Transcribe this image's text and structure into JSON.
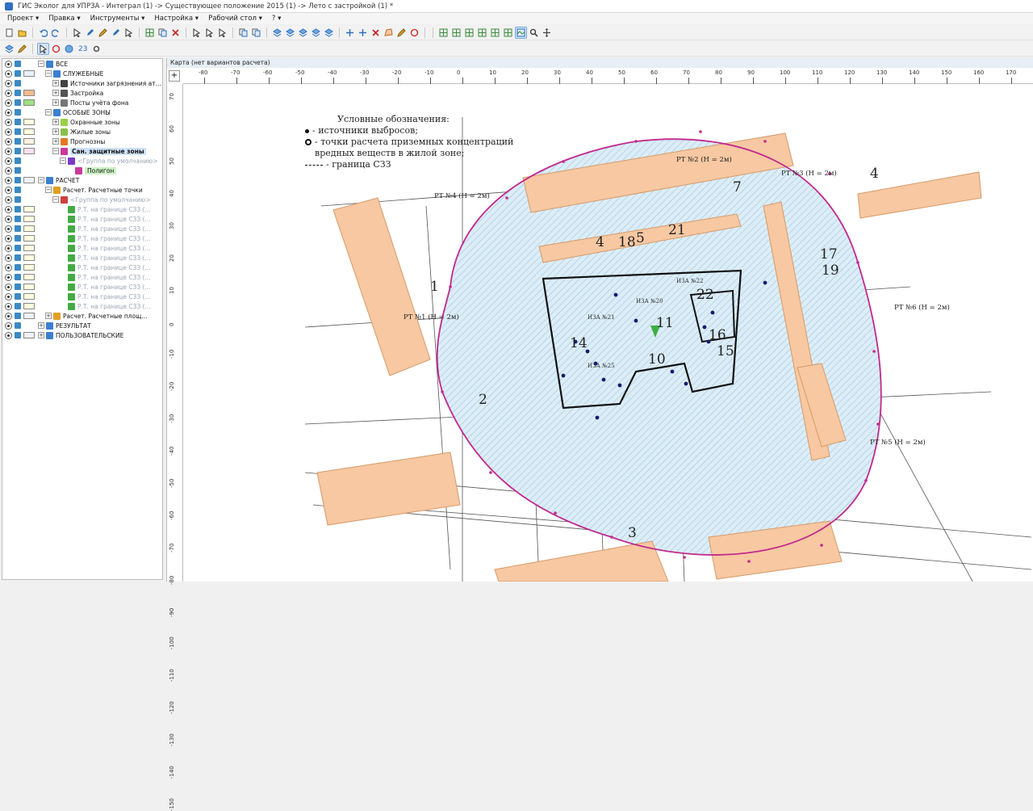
{
  "window": {
    "title": "ГИС Эколог для УПРЗА - Интеграл (1) -> Существующее положение 2015 (1) -> Лето с застройкой (1) *"
  },
  "menu": [
    "Проект ▾",
    "Правка ▾",
    "Инструменты ▾",
    "Настройка ▾",
    "Рабочий стол ▾",
    "? ▾"
  ],
  "toolbar": {
    "zoom_value": "23"
  },
  "tree": {
    "items": [
      {
        "label": "ВСЕ",
        "level": 0,
        "expand": "−",
        "icon": "folder-icon",
        "color": "#3b7fd1",
        "swatch": ""
      },
      {
        "label": "СЛУЖЕБНЫЕ",
        "level": 1,
        "expand": "−",
        "icon": "folder-icon",
        "color": "#3b7fd1",
        "swatch": "#e9f1fb"
      },
      {
        "label": "Источники загрязнения ат...",
        "level": 2,
        "expand": "+",
        "icon": "source-icon",
        "color": "#444",
        "swatch": ""
      },
      {
        "label": "Застройка",
        "level": 2,
        "expand": "+",
        "icon": "building-icon",
        "color": "#555",
        "swatch": "#f4b98c"
      },
      {
        "label": "Посты учёта фона",
        "level": 2,
        "expand": "+",
        "icon": "post-icon",
        "color": "#777",
        "swatch": "#9fe07e"
      },
      {
        "label": "ОСОБЫЕ ЗОНЫ",
        "level": 1,
        "expand": "−",
        "icon": "folder-icon",
        "color": "#3b7fd1",
        "swatch": ""
      },
      {
        "label": "Охранные зоны",
        "level": 2,
        "expand": "+",
        "icon": "zone-icon",
        "color": "#9ad04a",
        "swatch": "#ffffdf"
      },
      {
        "label": "Жилые зоны",
        "level": 2,
        "expand": "+",
        "icon": "zone-icon",
        "color": "#8ac04a",
        "swatch": "#ffffdf"
      },
      {
        "label": "Прогнозны",
        "level": 2,
        "expand": "+",
        "icon": "zone-icon",
        "color": "#e07a24",
        "swatch": "#fff2df"
      },
      {
        "label": "Сан. защитные зоны",
        "level": 2,
        "expand": "−",
        "icon": "zone-icon",
        "color": "#c93a9a",
        "swatch": "#fbe0f2",
        "highlight": true
      },
      {
        "label": "<Группа по умолчанию>",
        "level": 3,
        "expand": "−",
        "icon": "group-icon",
        "color": "#7a3ac9",
        "swatch": "",
        "faded": true
      },
      {
        "label": "Полигон",
        "level": 4,
        "expand": "",
        "icon": "polygon-icon",
        "color": "#c93a9a",
        "swatch": "",
        "green": true
      },
      {
        "label": "РАСЧЕТ",
        "level": 0,
        "expand": "−",
        "icon": "folder-icon",
        "color": "#3b7fd1",
        "swatch": "#eef2f8"
      },
      {
        "label": "Расчет. Расчетные точки",
        "level": 1,
        "expand": "−",
        "icon": "points-icon",
        "color": "#e0a024",
        "swatch": ""
      },
      {
        "label": "<Группа по умолчанию>",
        "level": 2,
        "expand": "−",
        "icon": "group-icon",
        "color": "#d04040",
        "swatch": "",
        "faded": true
      },
      {
        "label": "Р.Т. на границе СЗЗ (...",
        "level": 3,
        "expand": "",
        "icon": "point-icon",
        "color": "#4a4",
        "swatch": "#ffffdf",
        "faded": true
      },
      {
        "label": "Р.Т. на границе СЗЗ (...",
        "level": 3,
        "expand": "",
        "icon": "point-icon",
        "color": "#4a4",
        "swatch": "#ffffdf",
        "faded": true
      },
      {
        "label": "Р.Т. на границе СЗЗ (...",
        "level": 3,
        "expand": "",
        "icon": "point-icon",
        "color": "#4a4",
        "swatch": "#ffffdf",
        "faded": true
      },
      {
        "label": "Р.Т. на границе СЗЗ (...",
        "level": 3,
        "expand": "",
        "icon": "point-icon",
        "color": "#4a4",
        "swatch": "#ffffdf",
        "faded": true
      },
      {
        "label": "Р.Т. на границе СЗЗ (...",
        "level": 3,
        "expand": "",
        "icon": "point-icon",
        "color": "#4a4",
        "swatch": "#ffffdf",
        "faded": true
      },
      {
        "label": "Р.Т. на границе СЗЗ (...",
        "level": 3,
        "expand": "",
        "icon": "point-icon",
        "color": "#4a4",
        "swatch": "#ffffdf",
        "faded": true
      },
      {
        "label": "Р.Т. на границе СЗЗ (...",
        "level": 3,
        "expand": "",
        "icon": "point-icon",
        "color": "#4a4",
        "swatch": "#ffffdf",
        "faded": true
      },
      {
        "label": "Р.Т. на границе СЗЗ (...",
        "level": 3,
        "expand": "",
        "icon": "point-icon",
        "color": "#4a4",
        "swatch": "#ffffdf",
        "faded": true
      },
      {
        "label": "Р.Т. на границе СЗЗ (...",
        "level": 3,
        "expand": "",
        "icon": "point-icon",
        "color": "#4a4",
        "swatch": "#ffffdf",
        "faded": true
      },
      {
        "label": "Р.Т. на границе СЗЗ (...",
        "level": 3,
        "expand": "",
        "icon": "point-icon",
        "color": "#4a4",
        "swatch": "#ffffdf",
        "faded": true
      },
      {
        "label": "Р.Т. на границе СЗЗ (...",
        "level": 3,
        "expand": "",
        "icon": "point-icon",
        "color": "#4a4",
        "swatch": "#ffffdf",
        "faded": true
      },
      {
        "label": "Расчет. Расчетные площ...",
        "level": 1,
        "expand": "+",
        "icon": "grid-icon",
        "color": "#e0a024",
        "swatch": "#eef2f8"
      },
      {
        "label": "РЕЗУЛЬТАТ",
        "level": 0,
        "expand": "+",
        "icon": "folder-icon",
        "color": "#3b7fd1",
        "swatch": ""
      },
      {
        "label": "ПОЛЬЗОВАТЕЛЬСКИЕ",
        "level": 0,
        "expand": "+",
        "icon": "folder-icon",
        "color": "#3b7fd1",
        "swatch": "#eef2f8"
      }
    ]
  },
  "map": {
    "title": "Карта (нет вариантов расчета)",
    "corner_button": "+",
    "ruler_top": [
      "-80",
      "-70",
      "-60",
      "-50",
      "-40",
      "-30",
      "-20",
      "-10",
      "0",
      "10",
      "20",
      "30",
      "40",
      "50",
      "60",
      "70",
      "80",
      "90",
      "100",
      "110",
      "120",
      "130",
      "140",
      "150",
      "160",
      "170"
    ],
    "ruler_left": [
      "70",
      "60",
      "50",
      "40",
      "30",
      "20",
      "10",
      "0",
      "-10",
      "-20",
      "-30",
      "-40",
      "-50",
      "-60",
      "-70",
      "-80",
      "-90",
      "-100",
      "-110",
      "-120",
      "-130",
      "-140",
      "-150"
    ],
    "legend": {
      "heading": "Условные обозначения:",
      "items": [
        "- источники выбросов;",
        "- точки расчета приземных концентраций вредных веществ в жилой зоне;",
        "- граница СЗЗ"
      ]
    },
    "building_numbers": [
      "1",
      "2",
      "3",
      "4",
      "4",
      "5",
      "7",
      "10",
      "11",
      "14",
      "15",
      "16",
      "17",
      "18",
      "19",
      "21",
      "22"
    ],
    "point_labels": [
      "РТ №1 (H = 2м)",
      "РТ №2 (H = 2м)",
      "РТ №3 (H = 2м)",
      "РТ №4 (H = 2м)",
      "РТ №5 (H = 2м)",
      "РТ №6 (H = 2м)"
    ],
    "source_labels": [
      "ИЗА №20",
      "ИЗА №21",
      "ИЗА №22",
      "ИЗА №25"
    ],
    "colors": {
      "szz_boundary": "#c2288f",
      "building_fill": "#f7c8a1",
      "zone_hatch": "#cfe5f2",
      "source_dot": "#1a1a6e",
      "selected_marker": "#3cb043"
    }
  }
}
